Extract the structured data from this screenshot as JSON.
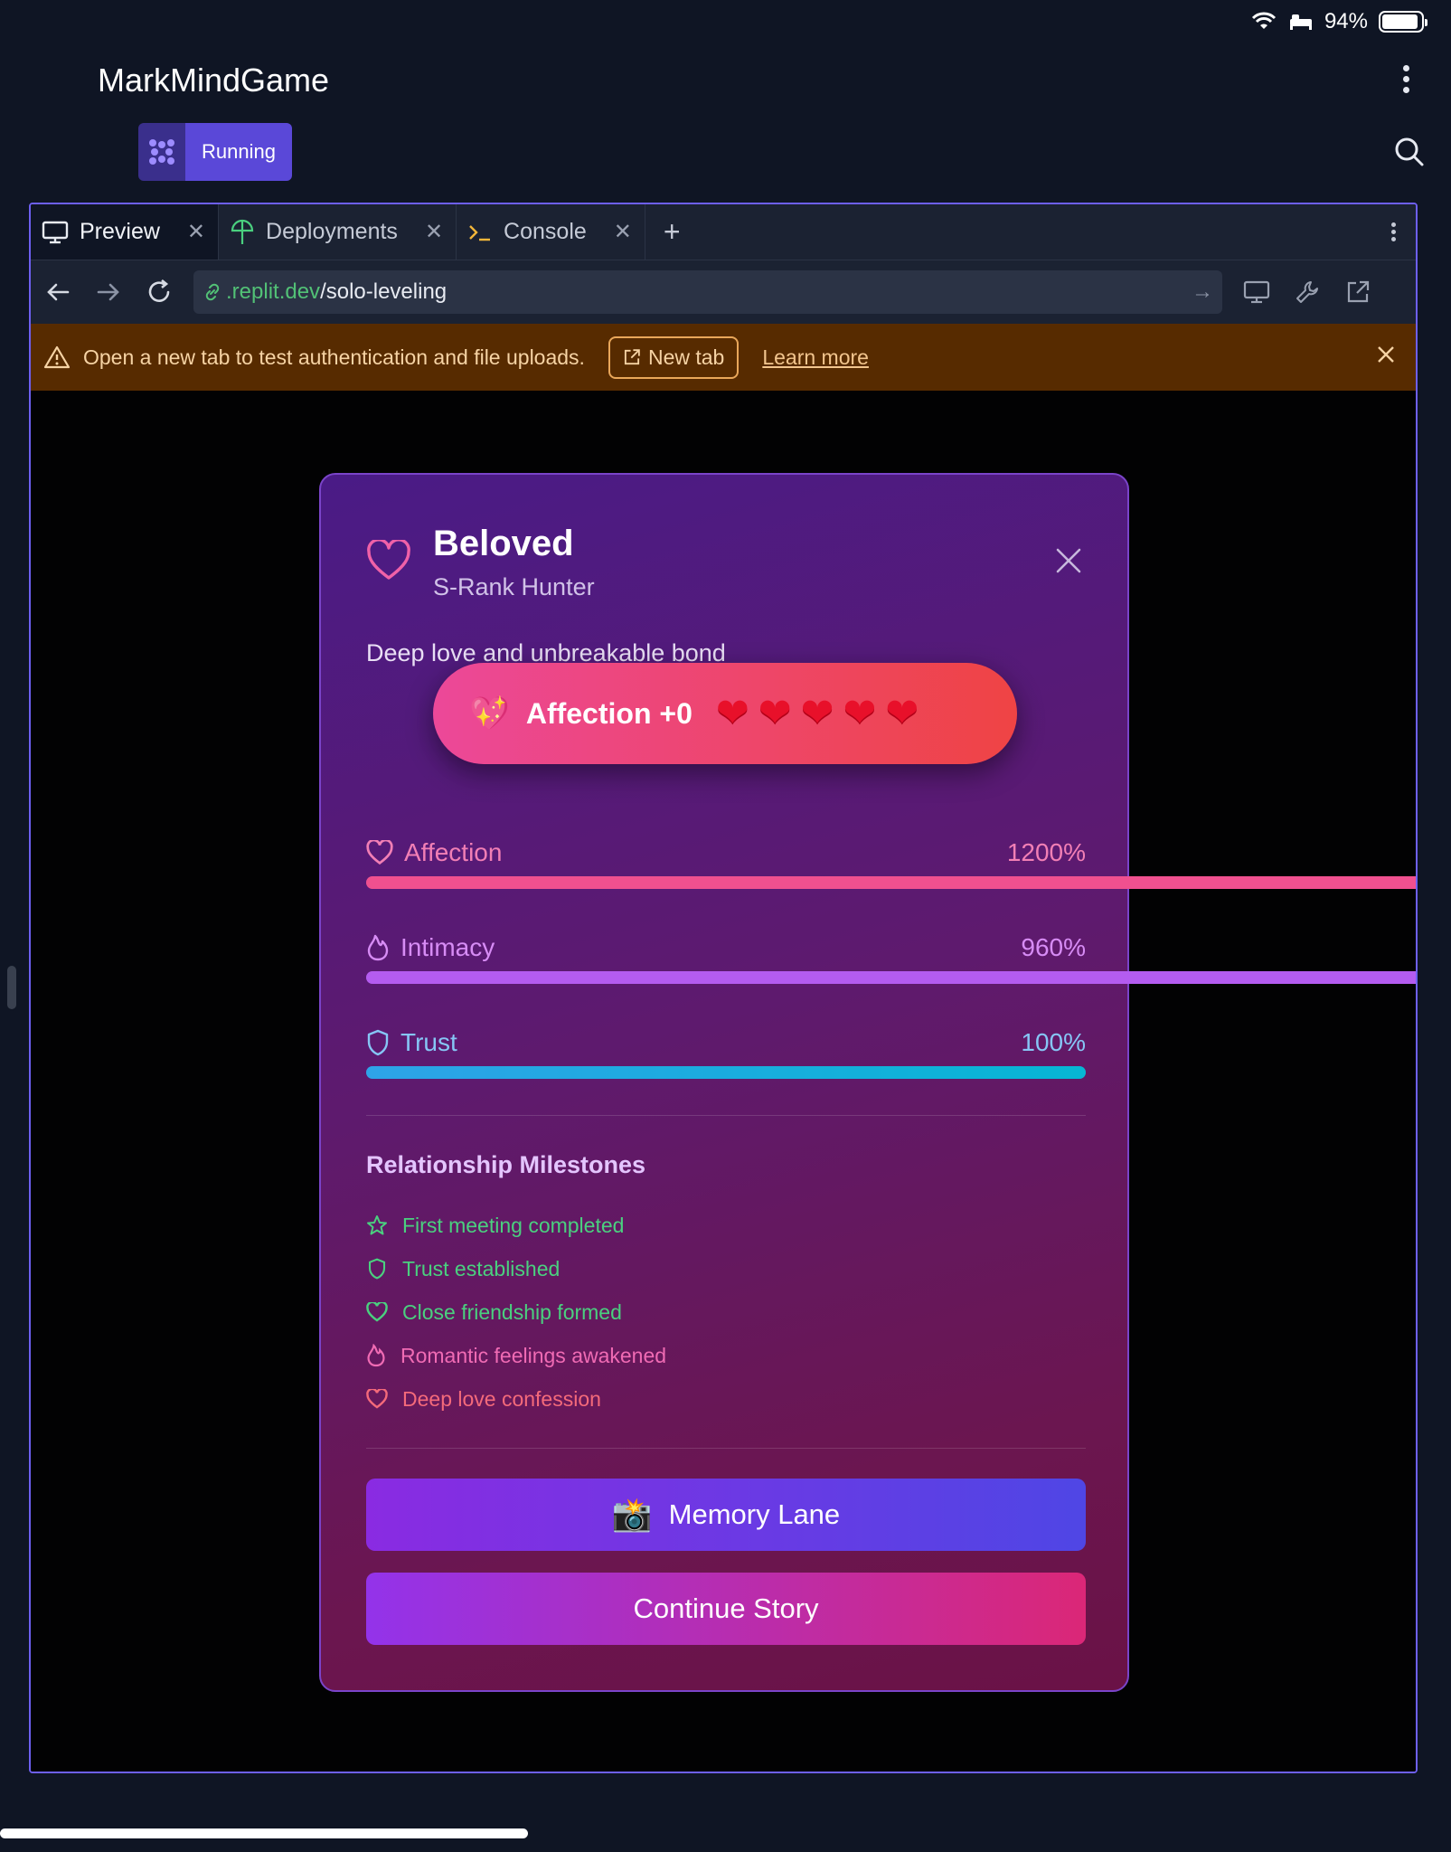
{
  "status_bar": {
    "battery_text": "94%",
    "battery_level": 0.94
  },
  "app": {
    "title": "MarkMindGame",
    "run_status": "Running"
  },
  "tabs": [
    {
      "label": "Preview",
      "icon": "monitor-icon",
      "active": true
    },
    {
      "label": "Deployments",
      "icon": "deploy-icon",
      "active": false
    },
    {
      "label": "Console",
      "icon": "terminal-icon",
      "active": false
    }
  ],
  "url": {
    "domain": ".replit.dev",
    "path": "/solo-leveling"
  },
  "banner": {
    "message": "Open a new tab to test authentication and file uploads.",
    "new_tab_label": "New tab",
    "learn_more_label": "Learn more"
  },
  "modal": {
    "title": "Beloved",
    "subtitle": "S-Rank Hunter",
    "description": "Deep love and unbreakable bond",
    "toast": {
      "emoji": "💖",
      "text": "Affection +0",
      "hearts": [
        "❤",
        "❤",
        "❤",
        "❤",
        "❤"
      ]
    },
    "stats": [
      {
        "label": "Affection",
        "value_text": "1200%",
        "value": 1200,
        "icon": "heart-icon",
        "color": "#f0508f"
      },
      {
        "label": "Intimacy",
        "value_text": "960%",
        "value": 960,
        "icon": "flame-icon",
        "color": "#b45cf0"
      },
      {
        "label": "Trust",
        "value_text": "100%",
        "value": 100,
        "icon": "shield-icon",
        "color": "#2ea3e8"
      }
    ],
    "milestones_title": "Relationship Milestones",
    "milestones": [
      {
        "label": "First meeting completed",
        "icon": "star-icon",
        "color": "#4ad07f"
      },
      {
        "label": "Trust established",
        "icon": "shield-icon",
        "color": "#4ad07f"
      },
      {
        "label": "Close friendship formed",
        "icon": "heart-icon",
        "color": "#4ad07f"
      },
      {
        "label": "Romantic feelings awakened",
        "icon": "flame-icon",
        "color": "#f06bb4"
      },
      {
        "label": "Deep love confession",
        "icon": "heart-icon",
        "color": "#f46a7a"
      }
    ],
    "memory_button": {
      "emoji": "📸",
      "label": "Memory Lane"
    },
    "continue_button": {
      "label": "Continue Story"
    }
  }
}
